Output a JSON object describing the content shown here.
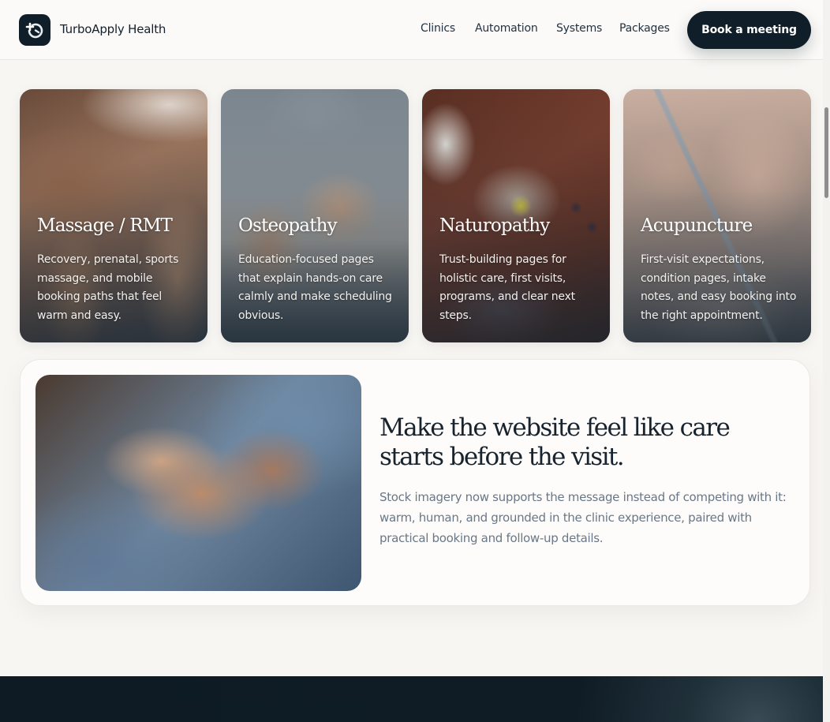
{
  "header": {
    "brand": "TurboApply Health",
    "nav": [
      "Clinics",
      "Automation",
      "Systems",
      "Packages"
    ],
    "cta": "Book a meeting"
  },
  "cards": [
    {
      "title": "Massage / RMT",
      "desc": "Recovery, prenatal, sports massage, and mobile booking paths that feel warm and easy."
    },
    {
      "title": "Osteopathy",
      "desc": "Education-focused pages that explain hands-on care calmly and make scheduling obvious."
    },
    {
      "title": "Naturopathy",
      "desc": "Trust-building pages for holistic care, first visits, programs, and clear next steps."
    },
    {
      "title": "Acupuncture",
      "desc": "First-visit expectations, condition pages, intake notes, and easy booking into the right appointment."
    }
  ],
  "feature": {
    "heading": "Make the website feel like care starts before the visit.",
    "text": "Stock imagery now supports the message instead of competing with it: warm, human, and grounded in the clinic experience, paired with practical booking and follow-up details."
  },
  "colors": {
    "brand_dark": "#0f1e29",
    "page_bg": "#f8f6f3"
  },
  "icons": {
    "logo": "plus-circle-arrow-icon"
  }
}
